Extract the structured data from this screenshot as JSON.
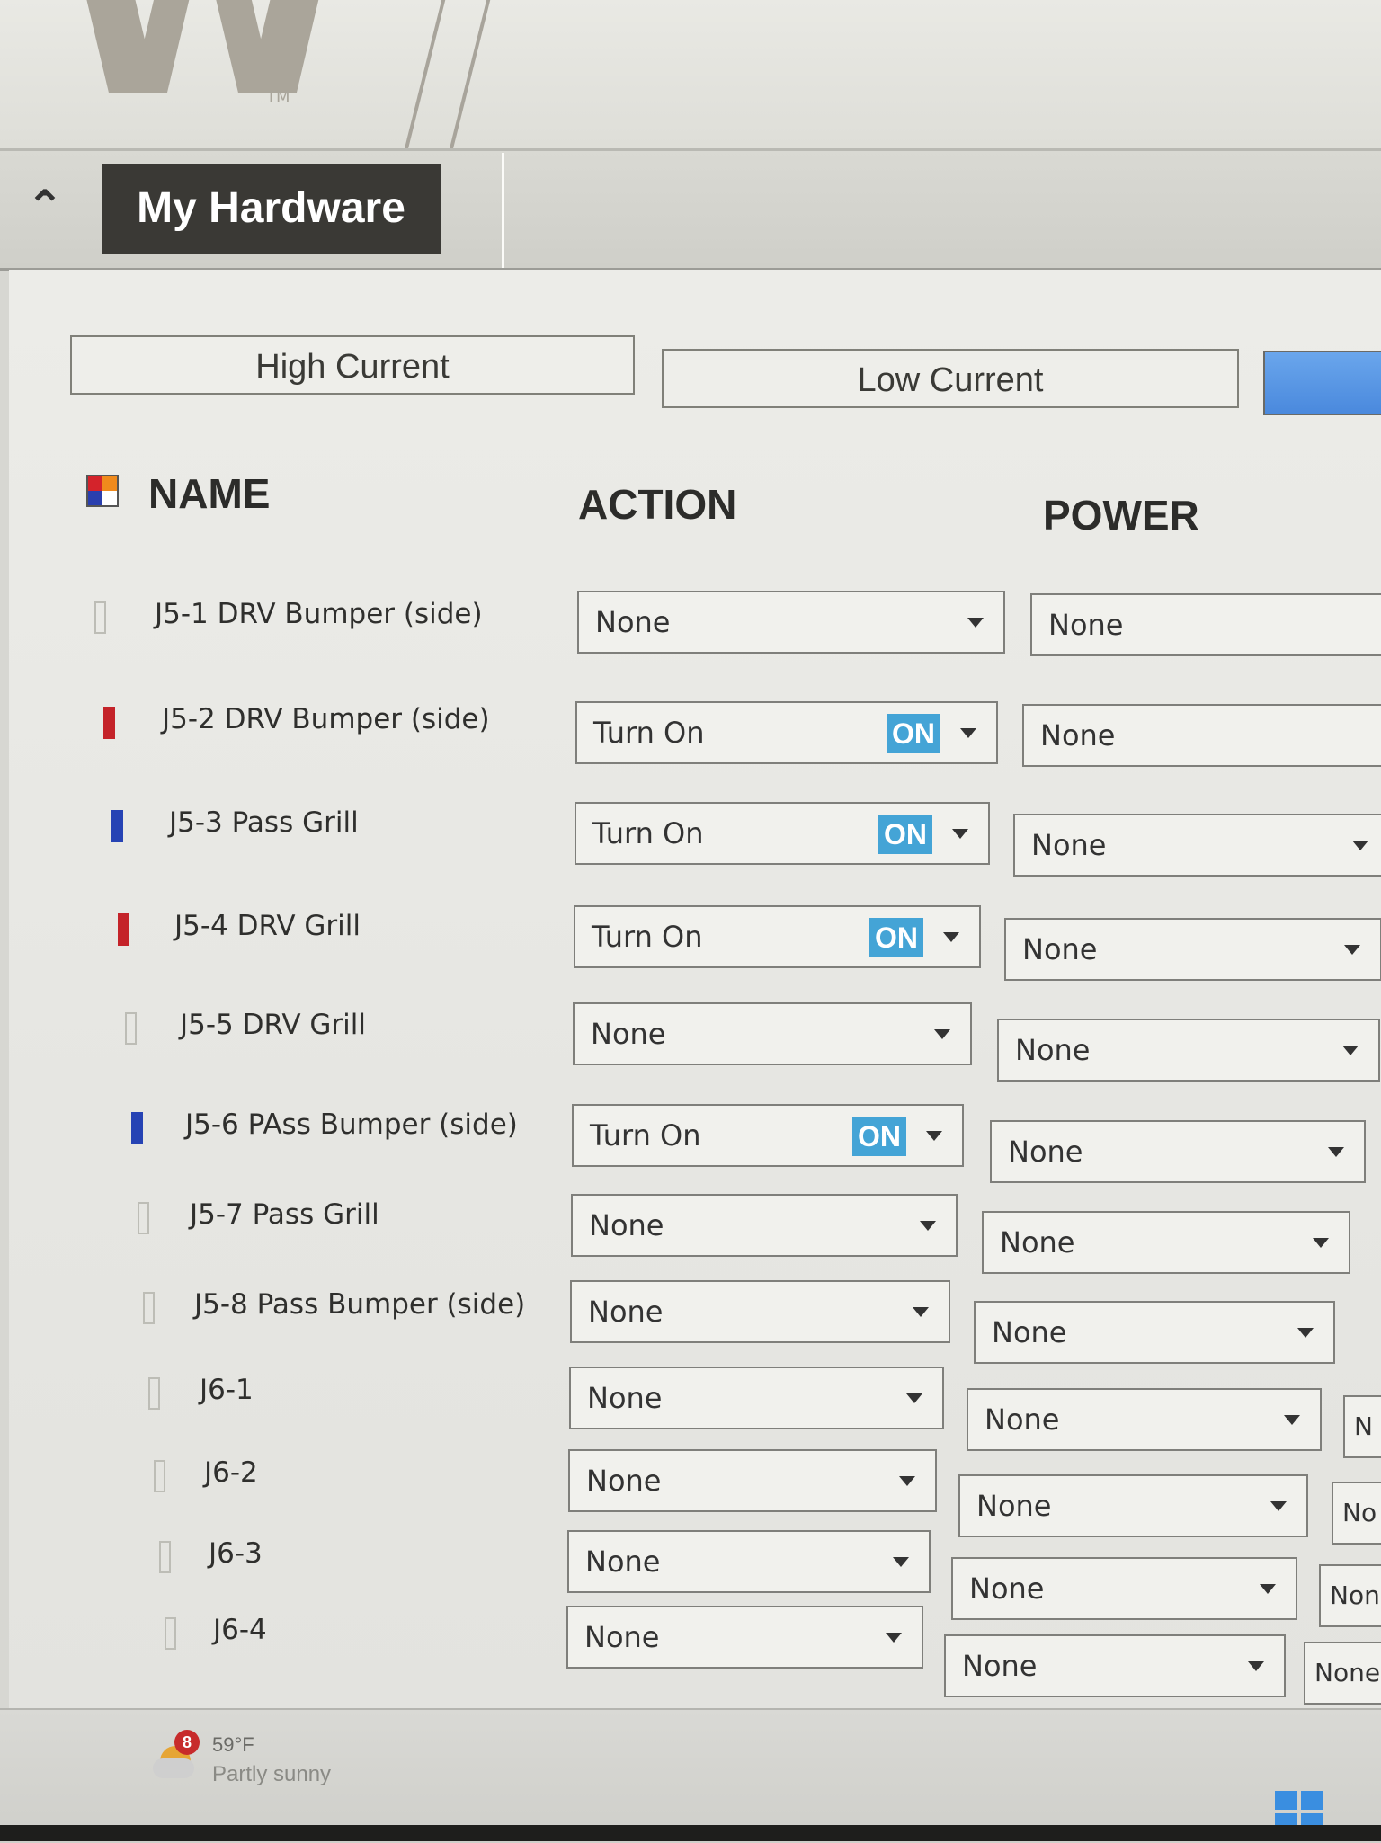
{
  "logo": {
    "letter": "W",
    "trademark": "TM"
  },
  "header": {
    "title": "My Hardware"
  },
  "tabs": {
    "high_current": "High Current",
    "low_current": "Low Current"
  },
  "columns": {
    "name": "NAME",
    "action": "ACTION",
    "power": "POWER"
  },
  "colors": {
    "red_marker": "#c42329",
    "blue_marker": "#2643b4",
    "on_badge": "#44a4d6",
    "tab_blue": "#4a89dd"
  },
  "rows": [
    {
      "name": "J5-1 DRV Bumper (side)",
      "marker": "empty",
      "action": "None",
      "action_badge": "",
      "power": "None"
    },
    {
      "name": "J5-2 DRV Bumper (side)",
      "marker": "red",
      "action": "Turn On",
      "action_badge": "ON",
      "power": "None"
    },
    {
      "name": "J5-3 Pass Grill",
      "marker": "blue",
      "action": "Turn On",
      "action_badge": "ON",
      "power": "None"
    },
    {
      "name": "J5-4 DRV Grill",
      "marker": "red",
      "action": "Turn On",
      "action_badge": "ON",
      "power": "None"
    },
    {
      "name": "J5-5 DRV Grill",
      "marker": "empty",
      "action": "None",
      "action_badge": "",
      "power": "None"
    },
    {
      "name": "J5-6 PAss Bumper (side)",
      "marker": "blue",
      "action": "Turn On",
      "action_badge": "ON",
      "power": "None"
    },
    {
      "name": "J5-7 Pass Grill",
      "marker": "empty",
      "action": "None",
      "action_badge": "",
      "power": "None"
    },
    {
      "name": "J5-8 Pass Bumper (side)",
      "marker": "empty",
      "action": "None",
      "action_badge": "",
      "power": "None"
    },
    {
      "name": "J6-1",
      "marker": "empty",
      "action": "None",
      "action_badge": "",
      "power": "None",
      "extra": "N"
    },
    {
      "name": "J6-2",
      "marker": "empty",
      "action": "None",
      "action_badge": "",
      "power": "None",
      "extra": "No"
    },
    {
      "name": "J6-3",
      "marker": "empty",
      "action": "None",
      "action_badge": "",
      "power": "None",
      "extra": "Non"
    },
    {
      "name": "J6-4",
      "marker": "empty",
      "action": "None",
      "action_badge": "",
      "power": "None",
      "extra": "None"
    }
  ],
  "taskbar": {
    "weather_badge": "8",
    "temperature": "59°F",
    "condition": "Partly sunny"
  }
}
